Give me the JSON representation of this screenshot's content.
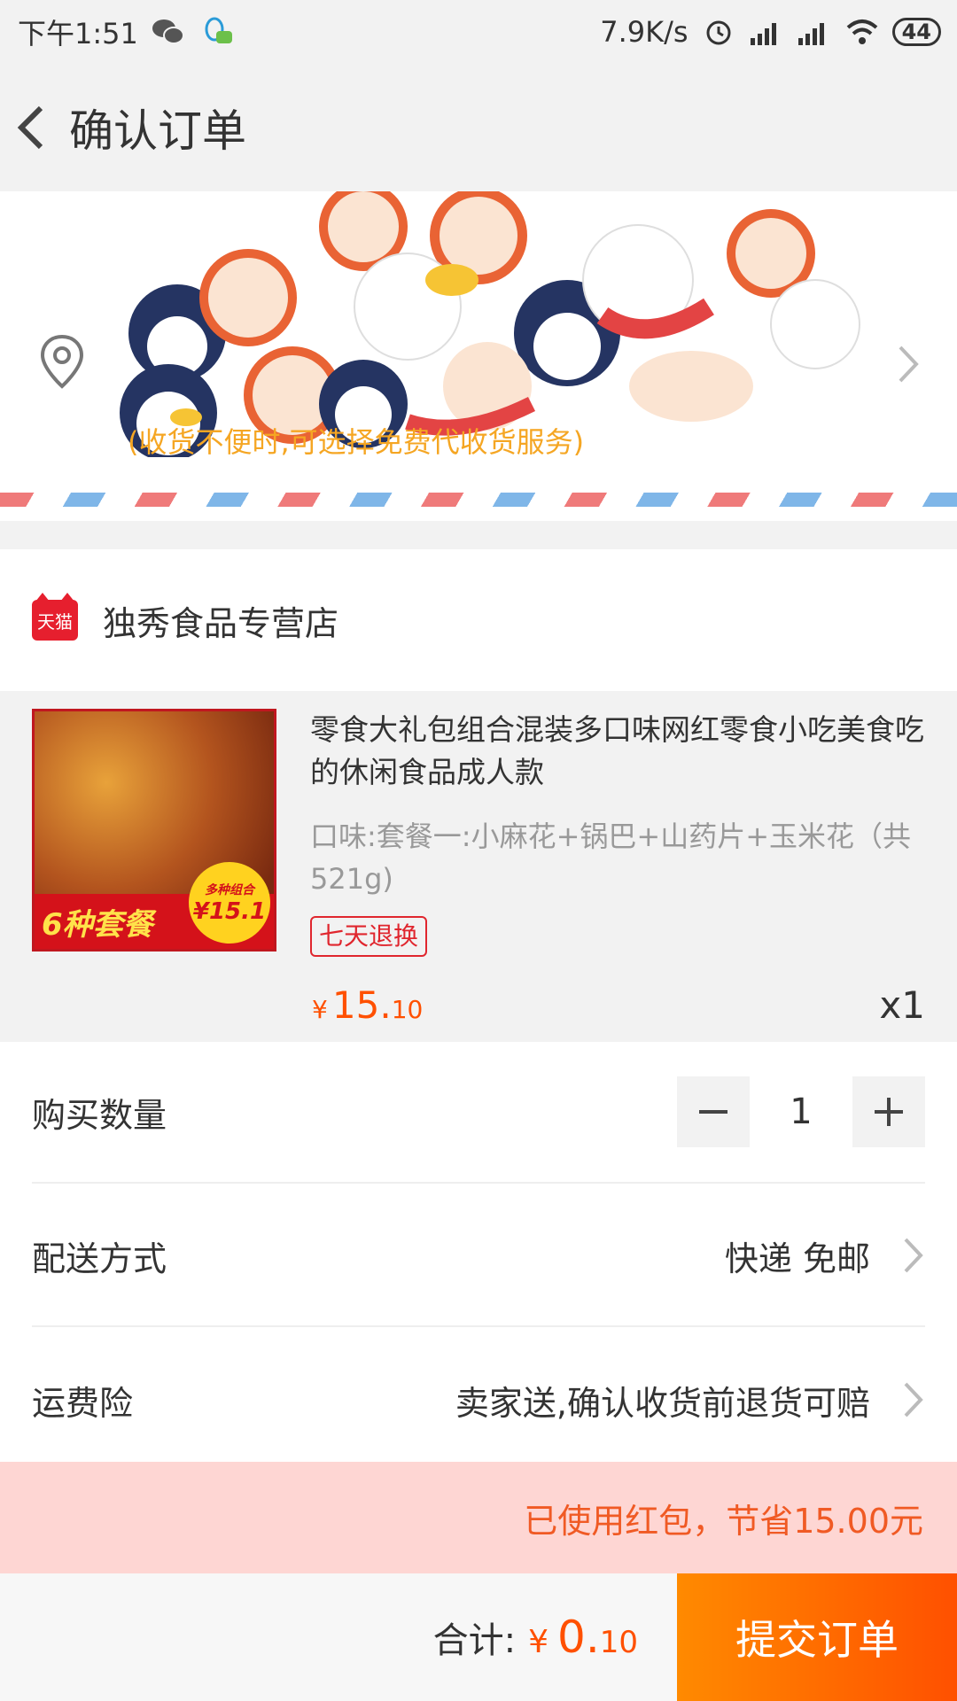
{
  "status_bar": {
    "time": "下午1:51",
    "net_speed": "7.9K/s",
    "battery": "44",
    "icons": [
      "wechat-icon",
      "qq-icon",
      "alarm-icon",
      "signal-icon",
      "signal-icon",
      "wifi-icon",
      "battery-icon"
    ]
  },
  "header": {
    "title": "确认订单"
  },
  "address": {
    "hint": "(收货不便时,可选择免费代收货服务)"
  },
  "shop": {
    "logo_text": "天猫",
    "name": "独秀食品专营店"
  },
  "product": {
    "title": "零食大礼包组合混装多口味网红零食小吃美食吃的休闲食品成人款",
    "spec": "口味:套餐一:小麻花+锅巴+山药片+玉米花（共521g)",
    "tag": "七天退换",
    "thumb_banner": "6种套餐",
    "thumb_badge_top": "多种组合",
    "thumb_badge_price": "¥15.1",
    "price_currency": "¥",
    "price_int": "15.",
    "price_dec": "10",
    "qty": "x1"
  },
  "rows": {
    "quantity_label": "购买数量",
    "quantity_value": "1",
    "shipping_label": "配送方式",
    "shipping_value": "快递 免邮",
    "insurance_label": "运费险",
    "insurance_value": "卖家送,确认收货前退货可赔"
  },
  "redpacket": {
    "text": "已使用红包，节省15.00元"
  },
  "footer": {
    "total_label": "合计:",
    "total_currency": "¥",
    "total_int": "0.",
    "total_dec": "10",
    "submit_label": "提交订单"
  },
  "colors": {
    "accent": "#ff5000",
    "hint": "#f5a623",
    "redpacket_bg": "#fed6d3",
    "tag": "#e0262e"
  }
}
